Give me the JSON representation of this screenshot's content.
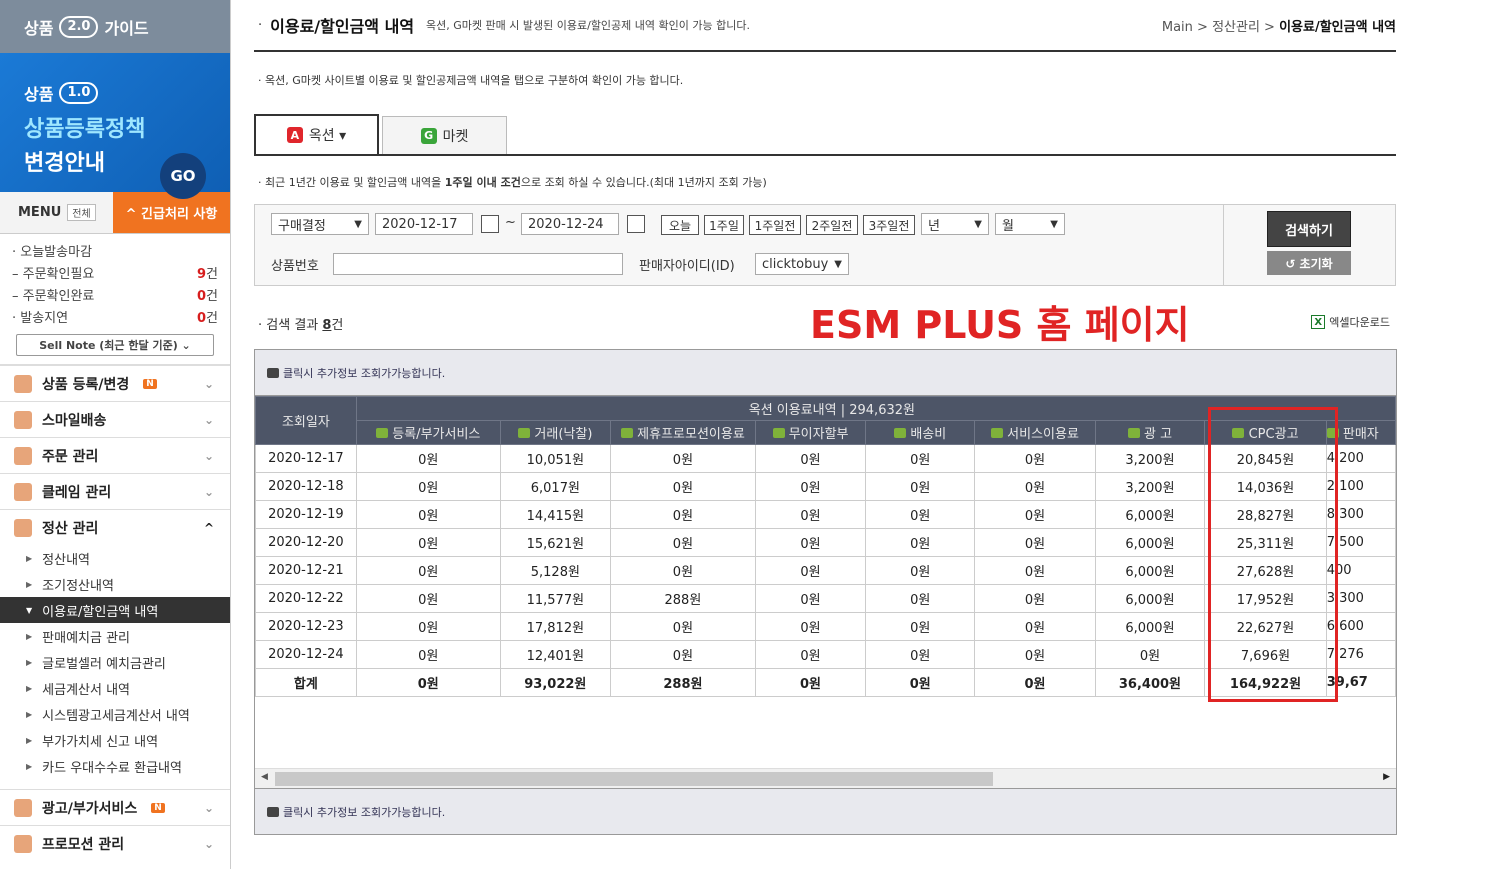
{
  "sidebar": {
    "guide_prefix": "상품",
    "guide_version": "2.0",
    "guide_suffix": "가이드",
    "banner_prefix": "상품",
    "banner_version": "1.0",
    "banner_line2": "상품등록정책",
    "banner_line3": "변경안내",
    "banner_go": "GO",
    "menu_label": "MENU",
    "menu_all": "전체",
    "urgent": "^ 긴급처리 사항",
    "status": [
      {
        "label": "· 오늘발송마감",
        "count": "",
        "unit": ""
      },
      {
        "label": "– 주문확인필요",
        "count": "9",
        "unit": "건"
      },
      {
        "label": "– 주문확인완료",
        "count": "0",
        "unit": "건"
      },
      {
        "label": "· 발송지연",
        "count": "0",
        "unit": "건"
      }
    ],
    "sellnote": "Sell Note (최근 한달 기준) ⌄",
    "sections": [
      {
        "label": "상품 등록/변경",
        "badge": "N"
      },
      {
        "label": "스마일배송",
        "badge": ""
      },
      {
        "label": "주문 관리",
        "badge": ""
      },
      {
        "label": "클레임 관리",
        "badge": ""
      },
      {
        "label": "정산 관리",
        "badge": ""
      }
    ],
    "sub_items": [
      "정산내역",
      "조기정산내역",
      "이용료/할인금액 내역",
      "판매예치금 관리",
      "글로벌셀러 예치금관리",
      "세금계산서 내역",
      "시스템광고세금계산서 내역",
      "부가가치세 신고 내역",
      "카드 우대수수료 환급내역"
    ],
    "sections_bottom": [
      {
        "label": "광고/부가서비스",
        "badge": "N"
      },
      {
        "label": "프로모션 관리",
        "badge": ""
      }
    ]
  },
  "header": {
    "title": "이용료/할인금액 내역",
    "desc": "옥션, G마켓 판매 시 발생된 이용료/할인공제 내역 확인이 가능 합니다.",
    "crumb_main": "Main > 정산관리 > ",
    "crumb_current": "이용료/할인금액 내역"
  },
  "note1": "· 옥션, G마켓 사이트별 이용료 및 할인공제금액 내역을 탭으로 구분하여 확인이 가능 합니다.",
  "tabs": [
    {
      "logo": "A",
      "label": "옥션 ▾",
      "color": "#e0262c"
    },
    {
      "logo": "G",
      "label": "마켓",
      "color": "#3aa53a"
    }
  ],
  "note2_prefix": "· 최근 1년간 이용료 및 할인금액 내역을 ",
  "note2_bold": "1주일 이내 조건",
  "note2_suffix": "으로 조회 하실 수 있습니다.(최대 1년까지 조회 가능)",
  "search": {
    "type": "구매결정",
    "date_from": "2020-12-17",
    "tilde": "~",
    "date_to": "2020-12-24",
    "quick": [
      "오늘",
      "1주일",
      "1주일전",
      "2주일전",
      "3주일전"
    ],
    "year": "년",
    "month": "월",
    "product_label": "상품번호",
    "product_value": "",
    "seller_label": "판매자아이디(ID)",
    "seller_value": "clicktobuy",
    "search_btn": "검색하기",
    "reset_btn": "↺ 초기화"
  },
  "result": {
    "prefix": "· 검색 결과 ",
    "count": "8",
    "suffix": "건",
    "excel": "엑셀다운로드",
    "overlay": "ESM PLUS 홈 페이지"
  },
  "grid": {
    "hint": "클릭시 추가정보 조회가가능합니다.",
    "group_header": "옥션 이용료내역 | 294,632원",
    "date_header": "조회일자",
    "columns": [
      "등록/부가서비스",
      "거래(낙찰)",
      "제휴프로모션이용료",
      "무이자할부",
      "배송비",
      "서비스이용료",
      "광 고",
      "CPC광고",
      "판매자"
    ],
    "rows": [
      [
        "2020-12-17",
        "0원",
        "10,051원",
        "0원",
        "0원",
        "0원",
        "0원",
        "3,200원",
        "20,845원",
        "4,200"
      ],
      [
        "2020-12-18",
        "0원",
        "6,017원",
        "0원",
        "0원",
        "0원",
        "0원",
        "3,200원",
        "14,036원",
        "2,100"
      ],
      [
        "2020-12-19",
        "0원",
        "14,415원",
        "0원",
        "0원",
        "0원",
        "0원",
        "6,000원",
        "28,827원",
        "8,300"
      ],
      [
        "2020-12-20",
        "0원",
        "15,621원",
        "0원",
        "0원",
        "0원",
        "0원",
        "6,000원",
        "25,311원",
        "7,500"
      ],
      [
        "2020-12-21",
        "0원",
        "5,128원",
        "0원",
        "0원",
        "0원",
        "0원",
        "6,000원",
        "27,628원",
        "400"
      ],
      [
        "2020-12-22",
        "0원",
        "11,577원",
        "288원",
        "0원",
        "0원",
        "0원",
        "6,000원",
        "17,952원",
        "3,300"
      ],
      [
        "2020-12-23",
        "0원",
        "17,812원",
        "0원",
        "0원",
        "0원",
        "0원",
        "6,000원",
        "22,627원",
        "6,600"
      ],
      [
        "2020-12-24",
        "0원",
        "12,401원",
        "0원",
        "0원",
        "0원",
        "0원",
        "0원",
        "7,696원",
        "7,276"
      ]
    ],
    "total": [
      "합계",
      "0원",
      "93,022원",
      "288원",
      "0원",
      "0원",
      "0원",
      "36,400원",
      "164,922원",
      "39,67"
    ]
  },
  "colors": {
    "accent": "#f07320",
    "highlight": "#e02424",
    "header_bg": "#4d5567"
  }
}
